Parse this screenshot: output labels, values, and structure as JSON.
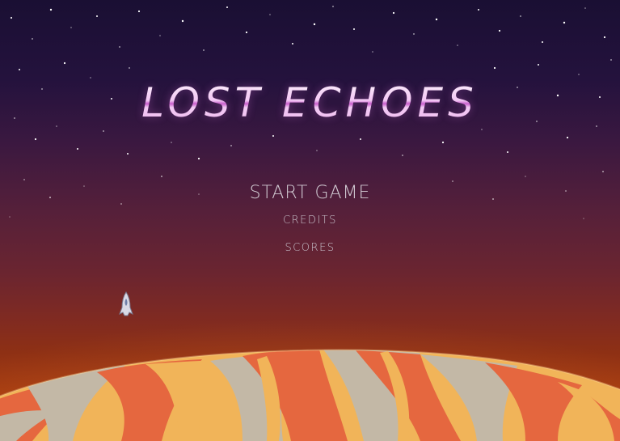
{
  "game": {
    "title": "LOST ECHOES"
  },
  "menu": {
    "start_label": "START GAME",
    "credits_label": "CREDITS",
    "scores_label": "SCORES"
  },
  "colors": {
    "title_gradient_light": "#f6d6f8",
    "title_gradient_dark": "#c55bc9",
    "menu_text": "#c9c2cc",
    "sky_top": "#1a0f33",
    "sky_bottom": "#b8430e",
    "planet_orange": "#e5673f",
    "planet_yellow": "#f1b459",
    "planet_grey": "#c3b8a6"
  },
  "icons": {
    "player": "spaceship-icon"
  }
}
